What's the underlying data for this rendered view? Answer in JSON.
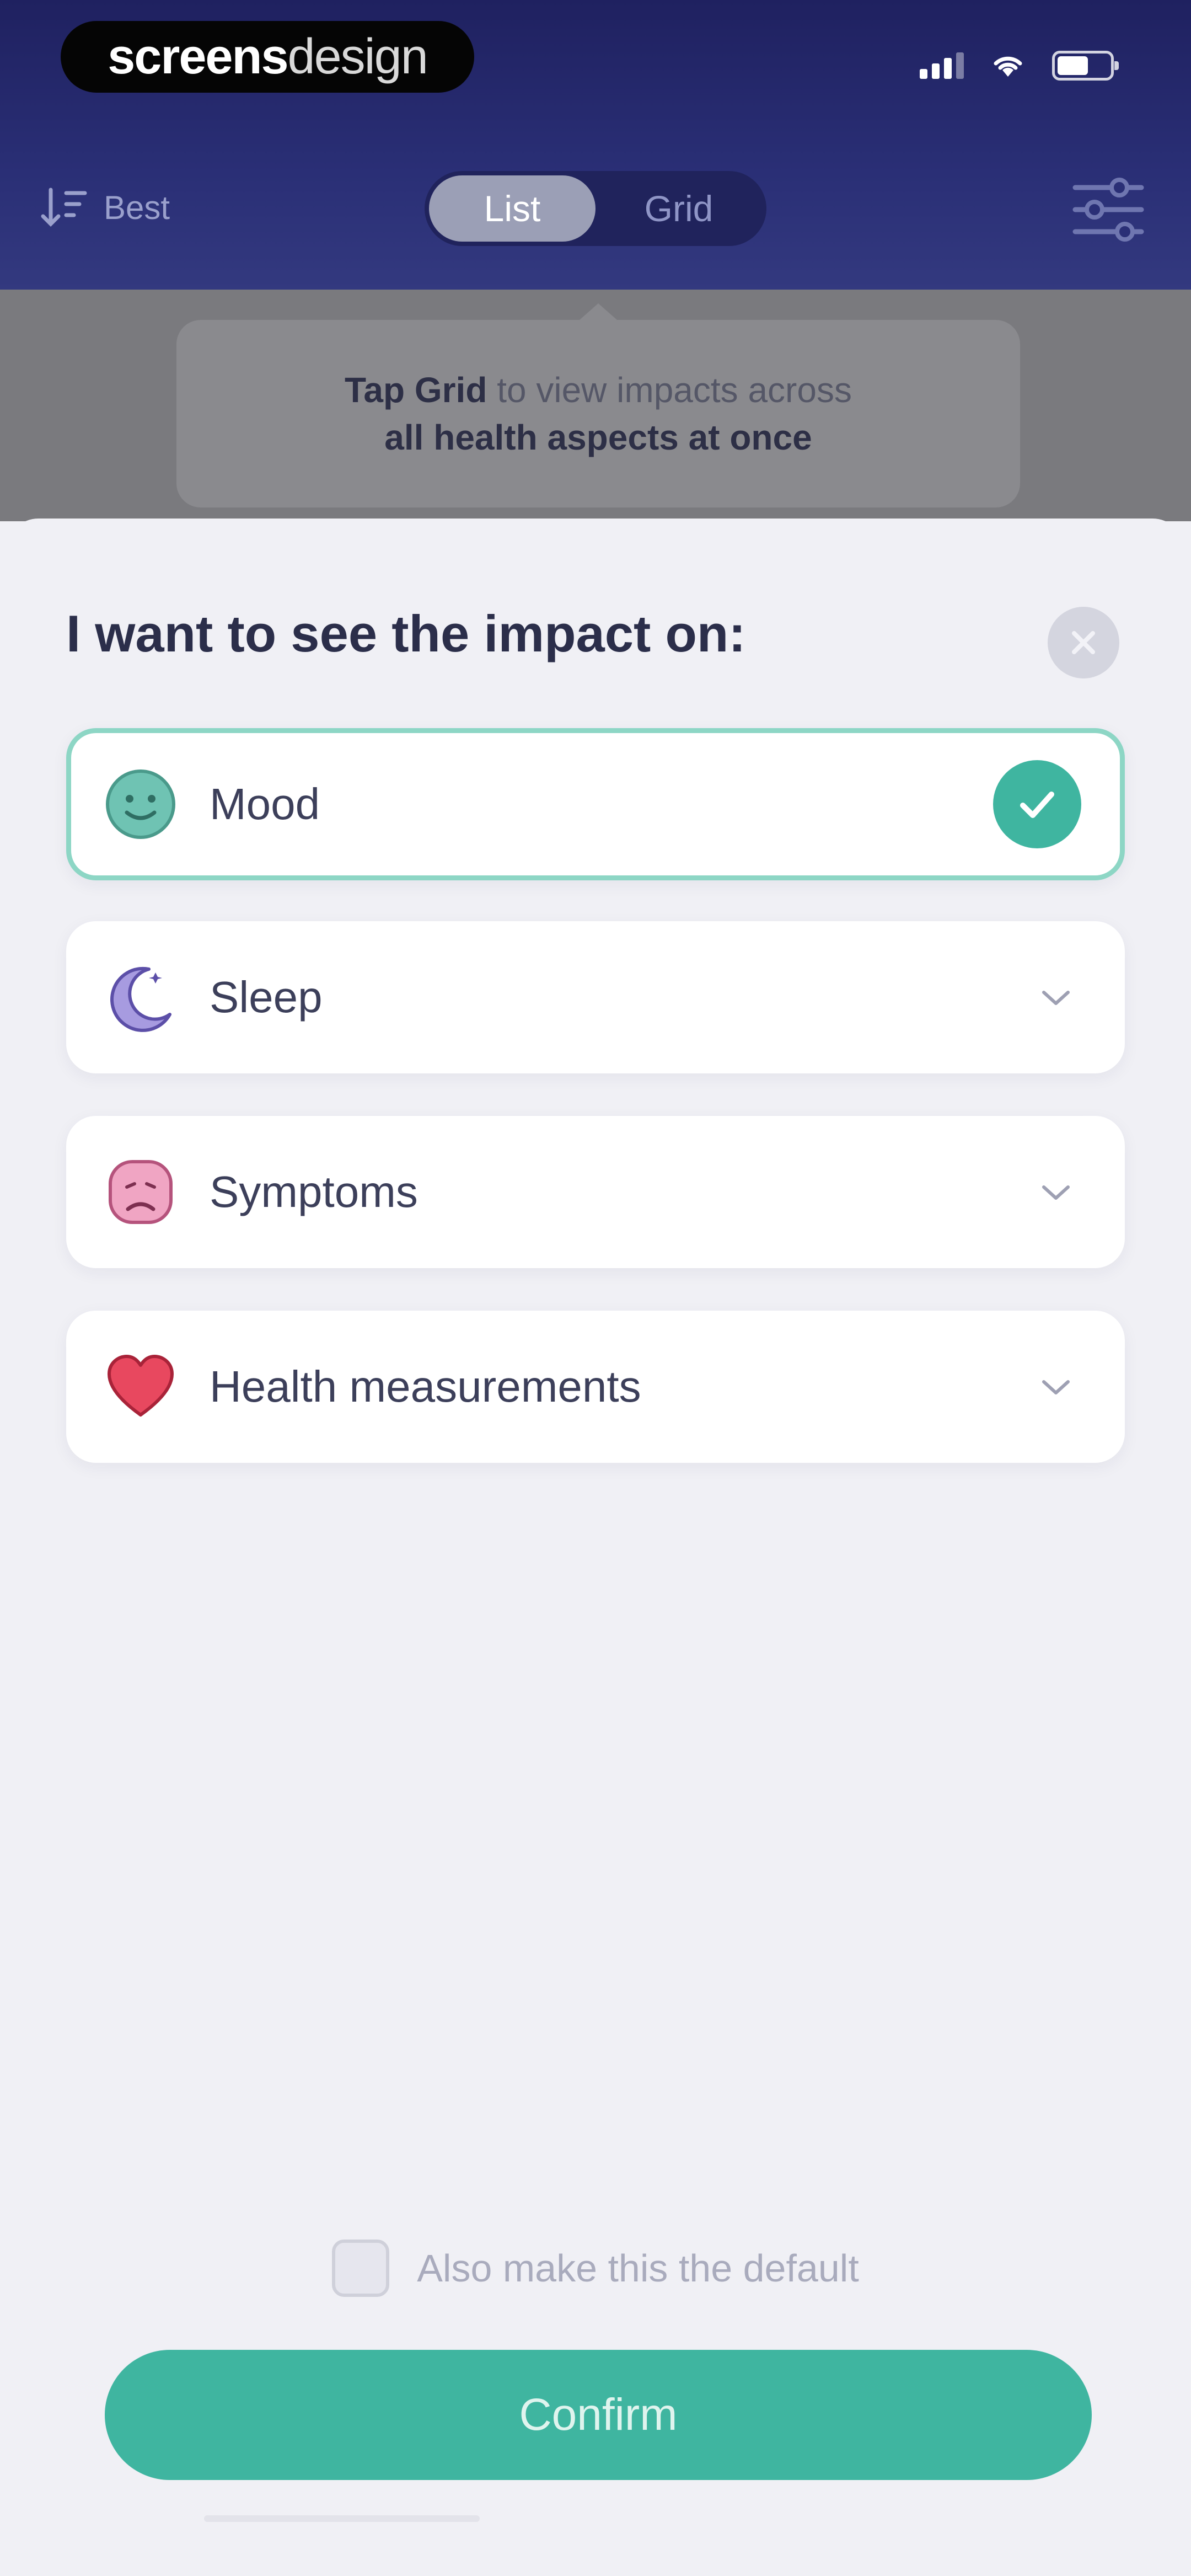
{
  "brand": {
    "bold": "screens",
    "thin": "design"
  },
  "toolbar": {
    "sort_label": "Best",
    "segments": [
      "List",
      "Grid"
    ],
    "active_segment": "List"
  },
  "tooltip": {
    "line1_bold": "Tap Grid",
    "line1_rest": " to view impacts across",
    "line2_bold": "all health aspects at once"
  },
  "sheet": {
    "title": "I want to see the impact on:",
    "options": [
      {
        "label": "Mood",
        "icon": "smiley-face-icon",
        "selected": true
      },
      {
        "label": "Sleep",
        "icon": "moon-icon",
        "selected": false
      },
      {
        "label": "Symptoms",
        "icon": "sad-face-icon",
        "selected": false
      },
      {
        "label": "Health measurements",
        "icon": "heart-icon",
        "selected": false
      }
    ],
    "default_label": "Also make this the default",
    "default_checked": false,
    "confirm_label": "Confirm"
  },
  "colors": {
    "accent": "#3fb5a0",
    "header": "#2a2f76",
    "title": "#2b2e4a"
  }
}
